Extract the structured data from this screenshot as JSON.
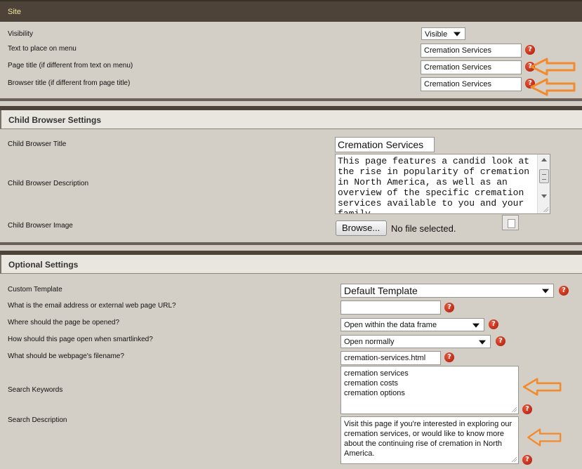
{
  "site": {
    "title": "Site",
    "visibility_label": "Visibility",
    "visibility_value": "Visible",
    "menu_text_label": "Text to place on menu",
    "menu_text_value": "Cremation Services",
    "page_title_label": "Page title (if different from text on menu)",
    "page_title_value": "Cremation Services",
    "browser_title_label": "Browser title (if different from page title)",
    "browser_title_value": "Cremation Services"
  },
  "child": {
    "title": "Child Browser Settings",
    "cb_title_label": "Child Browser Title",
    "cb_title_value": "Cremation Services",
    "cb_desc_label": "Child Browser Description",
    "cb_desc_value": "This page features a candid look at the rise in popularity of cremation in North America, as well as an overview of the specific cremation services available to you and your family.",
    "cb_image_label": "Child Browser Image",
    "browse_label": "Browse...",
    "no_file_text": "No file selected."
  },
  "optional": {
    "title": "Optional Settings",
    "template_label": "Custom Template",
    "template_value": "Default Template",
    "email_label": "What is the email address or external web page URL?",
    "email_value": "",
    "opened_label": "Where should the page be opened?",
    "opened_value": "Open within the data frame",
    "smartlink_label": "How should this page open when smartlinked?",
    "smartlink_value": "Open normally",
    "filename_label": "What should be webpage's filename?",
    "filename_value": "cremation-services.html",
    "keywords_label": "Search Keywords",
    "keywords": [
      "cremation services",
      "cremation costs",
      "cremation options"
    ],
    "desc_label": "Search Description",
    "desc_value": "Visit this page if you're interested in exploring our cremation services, or would like to know more about the continuing rise of cremation in North America."
  },
  "help_glyph": "?",
  "colors": {
    "header_bg": "#4e4338",
    "header_text": "#f2e4a4",
    "page_bg": "#d4cfc6",
    "annotation_arrow": "#f28a2e",
    "help_icon": "#c8280e"
  }
}
